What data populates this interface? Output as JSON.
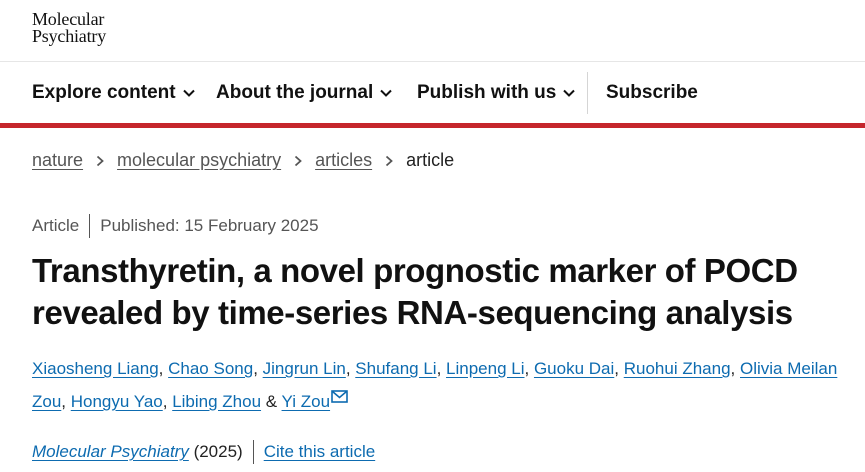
{
  "header": {
    "logo_line1": "Molecular",
    "logo_line2": "Psychiatry"
  },
  "nav": {
    "explore": "Explore content",
    "about": "About the journal",
    "publish": "Publish with us",
    "subscribe": "Subscribe"
  },
  "breadcrumb": {
    "items": [
      "nature",
      "molecular psychiatry",
      "articles"
    ],
    "current": "article"
  },
  "article": {
    "type": "Article",
    "published": "Published: 15 February 2025",
    "title": "Transthyretin, a novel prognostic marker of POCD revealed by time-series RNA-sequencing analysis",
    "authors": [
      "Xiaosheng Liang",
      "Chao Song",
      "Jingrun Lin",
      "Shufang Li",
      "Linpeng Li",
      "Guoku Dai",
      "Ruohui Zhang",
      "Olivia Meilan",
      "Zou",
      "Hongyu Yao",
      "Libing Zhou",
      "Yi Zou"
    ],
    "authors_and": "&",
    "journal": "Molecular Psychiatry",
    "year": "(2025)",
    "cite": "Cite this article"
  },
  "colors": {
    "accent": "#c5262c",
    "link": "#0d6bb0"
  },
  "icons": {
    "nav_chevron": "chevron-down-icon",
    "breadcrumb_sep": "chevron-right-icon",
    "corresponding": "mail-icon"
  }
}
